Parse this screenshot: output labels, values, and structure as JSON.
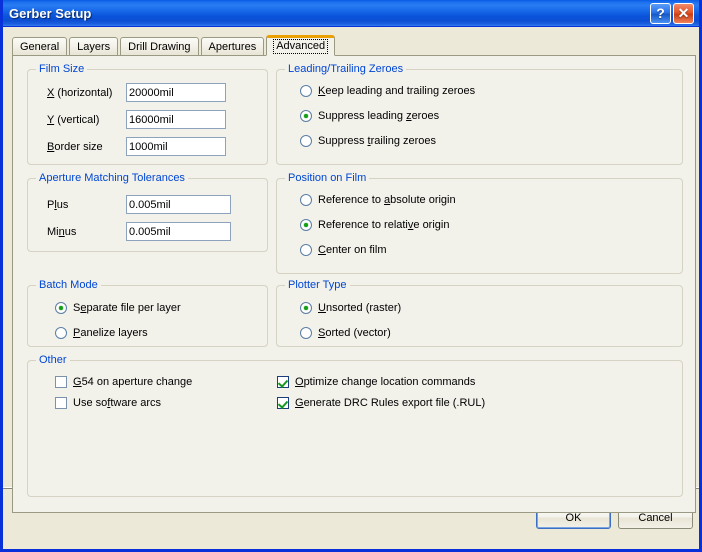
{
  "window": {
    "title": "Gerber Setup",
    "help_button": "?",
    "close_button": "✕"
  },
  "tabs": [
    {
      "label": "General",
      "selected": false
    },
    {
      "label": "Layers",
      "selected": false
    },
    {
      "label": "Drill Drawing",
      "selected": false
    },
    {
      "label": "Apertures",
      "selected": false
    },
    {
      "label": "Advanced",
      "selected": true
    }
  ],
  "groups": {
    "film_size": {
      "legend": "Film Size",
      "fields": [
        {
          "label_pre": "",
          "accesskey": "X",
          "label_post": " (horizontal)",
          "value": "20000mil"
        },
        {
          "label_pre": "",
          "accesskey": "Y",
          "label_post": " (vertical)",
          "value": "16000mil"
        },
        {
          "label_pre": "",
          "accesskey": "B",
          "label_post": "order size",
          "value": "1000mil"
        }
      ]
    },
    "aperture_tolerances": {
      "legend": "Aperture Matching Tolerances",
      "fields": [
        {
          "label_pre": "P",
          "accesskey": "l",
          "label_post": "us",
          "value": "0.005mil"
        },
        {
          "label_pre": "Mi",
          "accesskey": "n",
          "label_post": "us",
          "value": "0.005mil"
        }
      ]
    },
    "batch_mode": {
      "legend": "Batch Mode",
      "options": [
        {
          "label_pre": "S",
          "accesskey": "e",
          "label_post": "parate file per layer",
          "checked": true
        },
        {
          "label_pre": "",
          "accesskey": "P",
          "label_post": "anelize layers",
          "checked": false
        }
      ]
    },
    "leading_trailing_zeroes": {
      "legend": "Leading/Trailing Zeroes",
      "options": [
        {
          "label_pre": "",
          "accesskey": "K",
          "label_post": "eep leading and trailing zeroes",
          "checked": false
        },
        {
          "label_pre": "Suppress leading ",
          "accesskey": "z",
          "label_post": "eroes",
          "checked": true
        },
        {
          "label_pre": "Suppress ",
          "accesskey": "t",
          "label_post": "railing zeroes",
          "checked": false
        }
      ]
    },
    "position_on_film": {
      "legend": "Position on Film",
      "options": [
        {
          "label_pre": "Reference to ",
          "accesskey": "a",
          "label_post": "bsolute origin",
          "checked": false
        },
        {
          "label_pre": "Reference to relati",
          "accesskey": "v",
          "label_post": "e origin",
          "checked": true
        },
        {
          "label_pre": "",
          "accesskey": "C",
          "label_post": "enter on film",
          "checked": false
        }
      ]
    },
    "plotter_type": {
      "legend": "Plotter Type",
      "options": [
        {
          "label_pre": "",
          "accesskey": "U",
          "label_post": "nsorted (raster)",
          "checked": true
        },
        {
          "label_pre": "",
          "accesskey": "S",
          "label_post": "orted (vector)",
          "checked": false
        }
      ]
    },
    "other": {
      "legend": "Other",
      "checkboxes_left": [
        {
          "label_pre": "",
          "accesskey": "G",
          "label_post": "54 on aperture change",
          "checked": false
        },
        {
          "label_pre": "Use so",
          "accesskey": "f",
          "label_post": "tware arcs",
          "checked": false
        }
      ],
      "checkboxes_right": [
        {
          "label_pre": "",
          "accesskey": "O",
          "label_post": "ptimize change location commands",
          "checked": true
        },
        {
          "label_pre": "",
          "accesskey": "G",
          "label_post": "enerate DRC Rules export file (.RUL)",
          "checked": true
        }
      ]
    }
  },
  "buttons": {
    "ok": "OK",
    "cancel": "Cancel"
  },
  "colors": {
    "accent_title": "#0831d9",
    "legend_text": "#0046d5",
    "selected_tab_top": "#e9a000",
    "check_green": "#17991f",
    "radio_dot_green": "#14a014"
  }
}
